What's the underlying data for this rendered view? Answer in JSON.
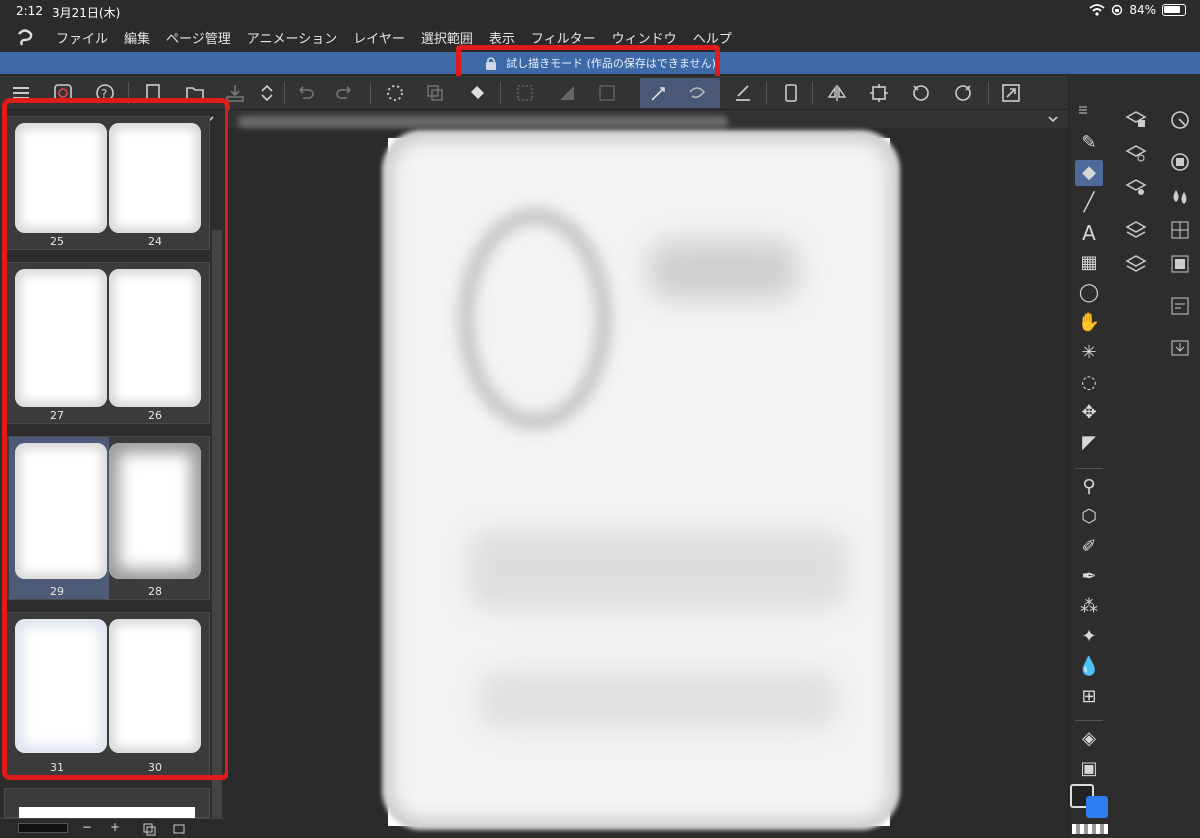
{
  "status": {
    "time": "2:12",
    "date": "3月21日(木)",
    "battery": "84%"
  },
  "menu": {
    "items": [
      "ファイル",
      "編集",
      "ページ管理",
      "アニメーション",
      "レイヤー",
      "選択範囲",
      "表示",
      "フィルター",
      "ウィンドウ",
      "ヘルプ"
    ]
  },
  "banner": {
    "text": "試し描きモード (作品の保存はできません)"
  },
  "pages": {
    "spreads": [
      {
        "left": "25",
        "right": "24"
      },
      {
        "left": "27",
        "right": "26"
      },
      {
        "left": "29",
        "right": "28",
        "selected": true
      },
      {
        "left": "31",
        "right": "30"
      }
    ],
    "bottom": {
      "minus": "−",
      "plus": "+"
    }
  },
  "colors": {
    "banner": "#3d6aa6",
    "annotation": "#e01b1b",
    "fg_color": "#2d7cf0",
    "bg_color": "#222222"
  }
}
